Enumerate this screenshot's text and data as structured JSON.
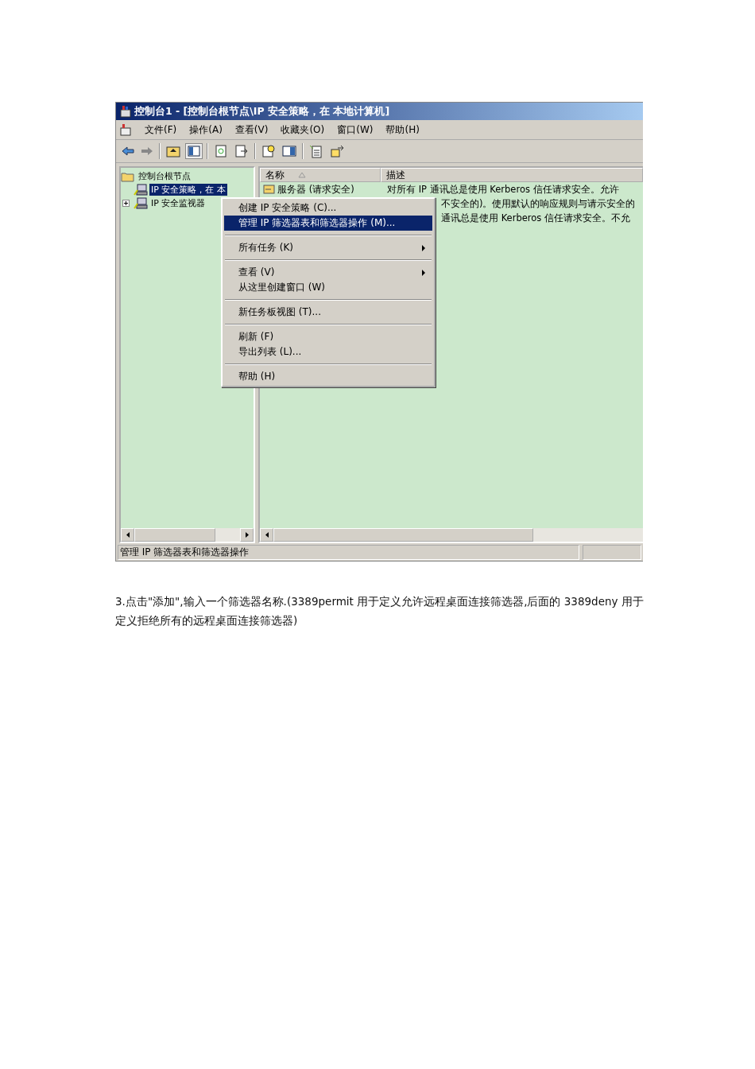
{
  "window": {
    "title": "控制台1 - [控制台根节点\\IP 安全策略，在 本地计算机]"
  },
  "menu_bar": [
    "文件(F)",
    "操作(A)",
    "查看(V)",
    "收藏夹(O)",
    "窗口(W)",
    "帮助(H)"
  ],
  "tree": [
    {
      "label": "控制台根节点",
      "selected": false,
      "children": [
        {
          "label": "IP 安全策略，在 本",
          "selected": true
        },
        {
          "label": "IP 安全监视器",
          "selected": false,
          "expanded": false
        }
      ]
    }
  ],
  "list": {
    "columns": [
      "名称",
      "描述"
    ],
    "rows": [
      {
        "name": "服务器 (请求安全)",
        "description": "对所有 IP 通讯总是使用 Kerberos 信任请求安全。允许"
      },
      {
        "description": "不安全的)。使用默认的响应规则与请示安全的"
      },
      {
        "description": "通讯总是使用 Kerberos 信任请求安全。不允"
      }
    ]
  },
  "context_menu": [
    [
      {
        "label": "创建 IP 安全策略 (C)...",
        "selected": false,
        "submenu": false
      },
      {
        "label": "管理 IP 筛选器表和筛选器操作 (M)...",
        "selected": true,
        "submenu": false
      }
    ],
    [
      {
        "label": "所有任务 (K)",
        "selected": false,
        "submenu": true
      }
    ],
    [
      {
        "label": "查看 (V)",
        "selected": false,
        "submenu": true
      },
      {
        "label": "从这里创建窗口 (W)",
        "selected": false,
        "submenu": false
      }
    ],
    [
      {
        "label": "新任务板视图 (T)...",
        "selected": false,
        "submenu": false
      }
    ],
    [
      {
        "label": "刷新 (F)",
        "selected": false,
        "submenu": false
      },
      {
        "label": "导出列表 (L)...",
        "selected": false,
        "submenu": false
      }
    ],
    [
      {
        "label": "帮助 (H)",
        "selected": false,
        "submenu": false
      }
    ]
  ],
  "status_bar": "管理 IP 筛选器表和筛选器操作",
  "caption": "3.点击\"添加\",输入一个筛选器名称.(3389permit 用于定义允许远程桌面连接筛选器,后面的 3389deny 用于定义拒绝所有的远程桌面连接筛选器)"
}
